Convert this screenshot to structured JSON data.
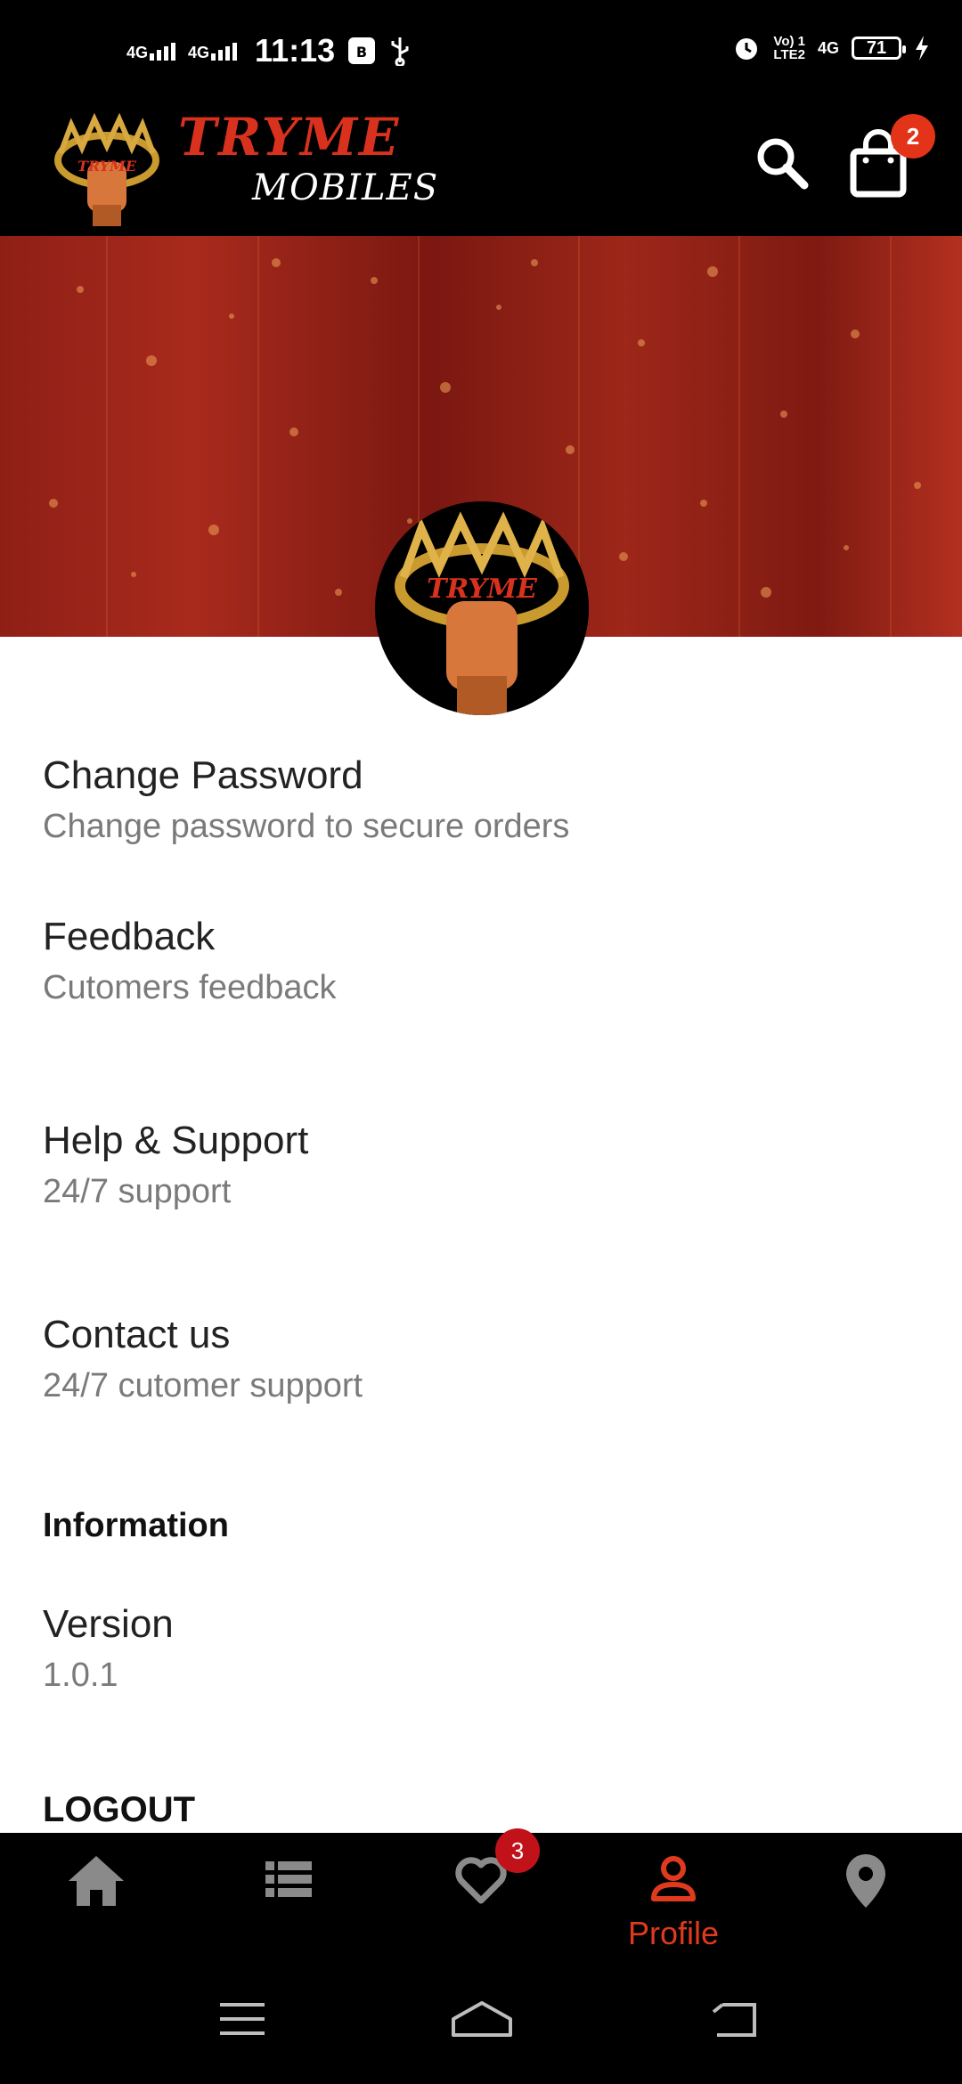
{
  "status_bar": {
    "net1": "4G",
    "net2": "4G",
    "time": "11:13",
    "volte_top": "Vo) 1",
    "volte_bottom": "LTE2",
    "net3": "4G",
    "battery": "71"
  },
  "header": {
    "brand_title": "TRYME",
    "brand_subtitle": "MOBILES",
    "cart_count": "2"
  },
  "menu": [
    {
      "title": "Change Password",
      "subtitle": "Change password to secure orders"
    },
    {
      "title": "Feedback",
      "subtitle": "Cutomers feedback"
    },
    {
      "title": "Help & Support",
      "subtitle": "24/7 support"
    },
    {
      "title": "Contact us",
      "subtitle": "24/7 cutomer support"
    }
  ],
  "information": {
    "heading": "Information",
    "version_label": "Version",
    "version_value": "1.0.1"
  },
  "logout_label": "LOGOUT",
  "bottom_nav": {
    "items": [
      {
        "icon": "home-icon"
      },
      {
        "icon": "list-icon"
      },
      {
        "icon": "heart-icon",
        "badge": "3"
      },
      {
        "icon": "person-icon",
        "label": "Profile",
        "active": true
      },
      {
        "icon": "location-pin-icon"
      }
    ]
  },
  "colors": {
    "accent": "#e03a1e",
    "header_bg": "#000000",
    "banner_red": "#9d2719"
  }
}
